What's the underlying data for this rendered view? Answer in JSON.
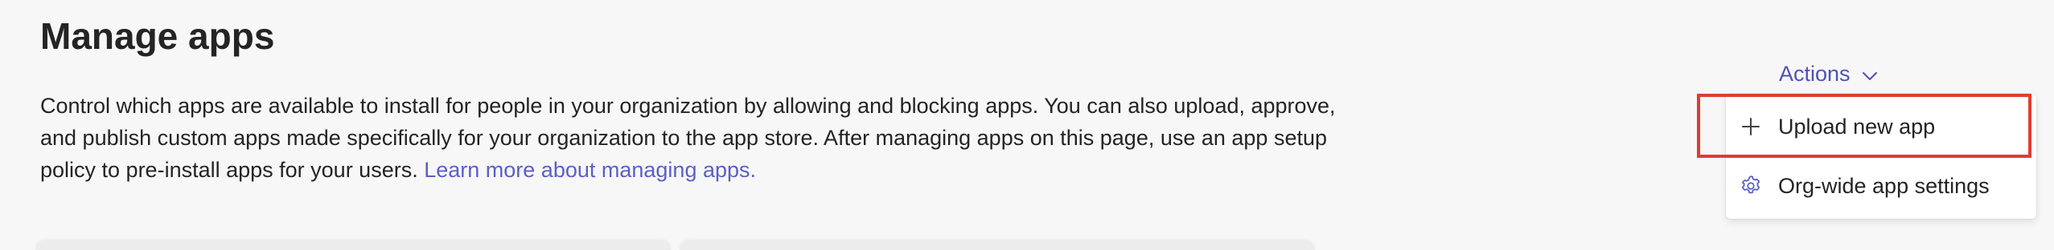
{
  "page": {
    "title": "Manage apps",
    "description": "Control which apps are available to install for people in your organization by allowing and blocking apps. You can also upload, approve, and publish custom apps made specifically for your organization to the app store. After managing apps on this page, use an app setup policy to pre-install apps for your users.",
    "learn_more_link": "Learn more about managing apps."
  },
  "actions": {
    "label": "Actions",
    "icon": "chevron-down-icon",
    "menu": {
      "items": [
        {
          "label": "Upload new app",
          "icon": "plus-icon"
        },
        {
          "label": "Org-wide app settings",
          "icon": "gear-icon"
        }
      ]
    }
  },
  "highlight": {
    "color": "#e03c31",
    "target": "Upload new app"
  },
  "colors": {
    "accent": "#5b5fc7",
    "text": "#242424",
    "background": "#f7f7f7"
  }
}
